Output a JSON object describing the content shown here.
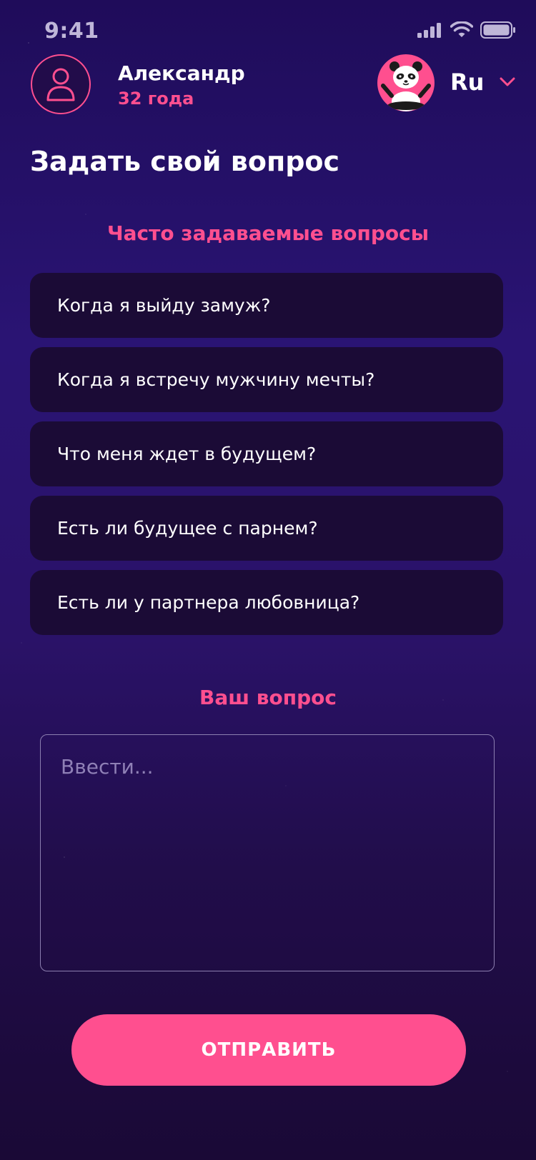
{
  "status_bar": {
    "time": "9:41",
    "icons": [
      "cellular-signal-icon",
      "wifi-icon",
      "battery-icon"
    ]
  },
  "header": {
    "user": {
      "name": "Александр",
      "age": "32 года",
      "avatar_icon": "user-icon"
    },
    "mascot_icon": "panda-icon",
    "language": {
      "selected": "Ru",
      "icon": "chevron-down-icon"
    }
  },
  "page": {
    "title": "Задать свой вопрос"
  },
  "faq": {
    "heading": "Часто задаваемые вопросы",
    "items": [
      "Когда я выйду замуж?",
      "Когда я встречу мужчину мечты?",
      "Что меня ждет в будущем?",
      "Есть ли будущее с парнем?",
      "Есть ли у партнера любовница?"
    ]
  },
  "question": {
    "heading": "Ваш вопрос",
    "placeholder": "Ввести...",
    "value": ""
  },
  "submit": {
    "label": "ОТПРАВИТЬ"
  },
  "colors": {
    "accent": "#ff4f8f",
    "background_top": "#1f0c5a",
    "background_bottom": "#1a0936",
    "card": "#1b0b36"
  }
}
